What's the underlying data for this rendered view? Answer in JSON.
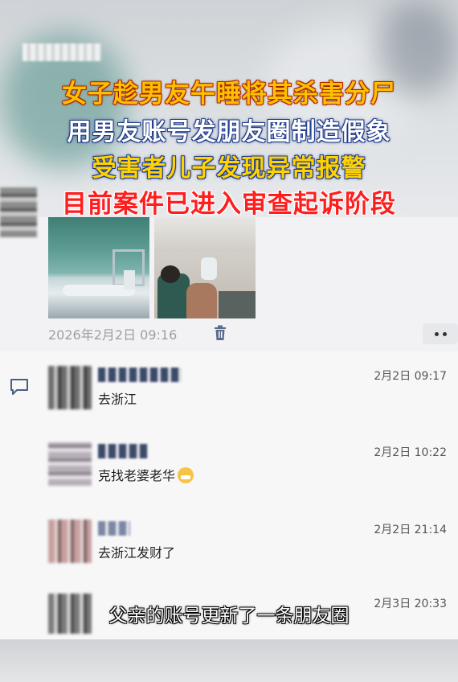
{
  "headlines": {
    "line1": "女子趁男友午睡将其杀害分尸",
    "line2": "用男友账号发朋友圈制造假象",
    "line3": "受害者儿子发现异常报警",
    "line4": "目前案件已进入审查起诉阶段"
  },
  "post": {
    "time": "2026年2月2日 09:16",
    "photos": [
      "airport-photo",
      "airplane-cabin-photo"
    ]
  },
  "comments": [
    {
      "text": "去浙江",
      "time": "2月2日 09:17"
    },
    {
      "text": "克找老婆老华",
      "time": "2月2日 10:22",
      "emoji": "grinning-face"
    },
    {
      "text": "去浙江发财了",
      "time": "2月2日 21:14"
    },
    {
      "text": "",
      "time": "2月3日 20:33"
    }
  ],
  "subtitle": "父亲的账号更新了一条朋友圈",
  "colors": {
    "headline_orange": "#ffbf00",
    "headline_yellow": "#ffd200",
    "headline_red": "#ff1e1e",
    "outline_blue": "#1e3a8a"
  }
}
